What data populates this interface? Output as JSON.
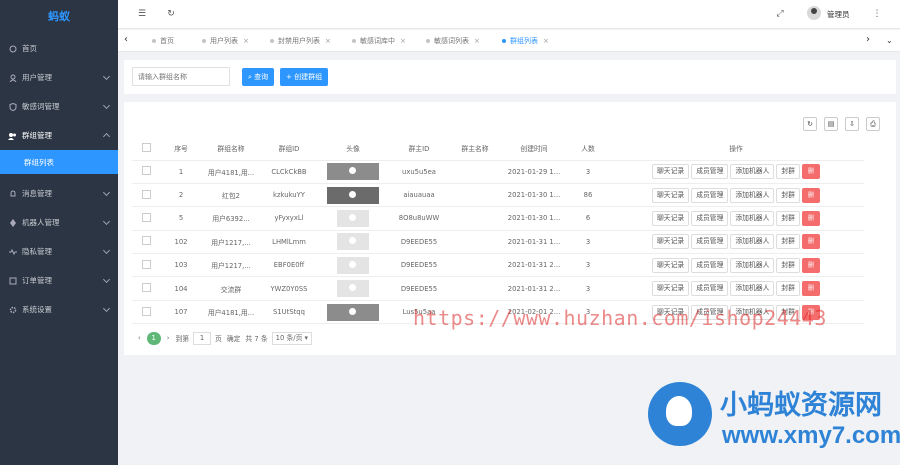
{
  "app": {
    "logo_text": "蚂蚁"
  },
  "sidebar": {
    "items": [
      {
        "label": "首页",
        "icon": "home-icon"
      },
      {
        "label": "用户管理",
        "icon": "user-icon"
      },
      {
        "label": "敏感词管理",
        "icon": "shield-icon"
      },
      {
        "label": "群组管理",
        "icon": "group-icon"
      },
      {
        "label": "群组列表",
        "icon": ""
      },
      {
        "label": "消息管理",
        "icon": "bell-icon"
      },
      {
        "label": "机器人管理",
        "icon": "robot-icon"
      },
      {
        "label": "隐私管理",
        "icon": "lock-icon"
      },
      {
        "label": "订单管理",
        "icon": "order-icon"
      },
      {
        "label": "系统设置",
        "icon": "gear-icon"
      }
    ]
  },
  "topbar": {
    "admin_name": "管理员"
  },
  "tabs": [
    {
      "label": "首页"
    },
    {
      "label": "用户列表"
    },
    {
      "label": "封禁用户列表"
    },
    {
      "label": "敏感词库中"
    },
    {
      "label": "敏感词列表"
    },
    {
      "label": "群组列表"
    }
  ],
  "search": {
    "placeholder": "请输入群组名称",
    "search_label": "查询",
    "add_label": "+ 创建群组"
  },
  "table": {
    "headers": [
      "序号",
      "群组名称",
      "群组ID",
      "头像",
      "群主ID",
      "群主名称",
      "创建时间",
      "人数",
      "操作"
    ],
    "rows": [
      {
        "no": "1",
        "name": "用户4181,用...",
        "gid": "CLCkCkBB",
        "owner": "uxu5u5ea",
        "owner_name": "",
        "time": "2021-01-29 1...",
        "count": "3"
      },
      {
        "no": "2",
        "name": "红包2",
        "gid": "kzkukuYY",
        "owner": "aiauauaa",
        "owner_name": "",
        "time": "2021-01-30 1...",
        "count": "86"
      },
      {
        "no": "5",
        "name": "用户6392...",
        "gid": "yFyxyxLl",
        "owner": "8O8u8uWW",
        "owner_name": "",
        "time": "2021-01-30 1...",
        "count": "6"
      },
      {
        "no": "102",
        "name": "用户1217,...",
        "gid": "LHMlLmm",
        "owner": "D9EEDE55",
        "owner_name": "",
        "time": "2021-01-31 1...",
        "count": "3"
      },
      {
        "no": "103",
        "name": "用户1217,...",
        "gid": "EBF0E0ff",
        "owner": "D9EEDE55",
        "owner_name": "",
        "time": "2021-01-31 2...",
        "count": "3"
      },
      {
        "no": "104",
        "name": "交流群",
        "gid": "YWZ0Y0SS",
        "owner": "D9EEDE55",
        "owner_name": "",
        "time": "2021-01-31 2...",
        "count": "3"
      },
      {
        "no": "107",
        "name": "用户4181,用...",
        "gid": "S1UtStqq",
        "owner": "Lus5u5aa",
        "owner_name": "",
        "time": "2021-02-01 2...",
        "count": "3"
      }
    ],
    "actions": {
      "chat": "聊天记录",
      "members": "成员管理",
      "add_bot": "添加机器人",
      "ban": "封群",
      "delete": "删"
    }
  },
  "pager": {
    "current": "1",
    "goto_label": "到第",
    "page_value": "1",
    "page_unit": "页",
    "confirm": "确定",
    "total": "共 7 条",
    "per_page": "10 条/页"
  },
  "watermark": {
    "url": "https://www.huzhan.com/ishop24443",
    "brand_cn": "小蚂蚁资源网",
    "brand_url": "www.xmy7.com"
  }
}
